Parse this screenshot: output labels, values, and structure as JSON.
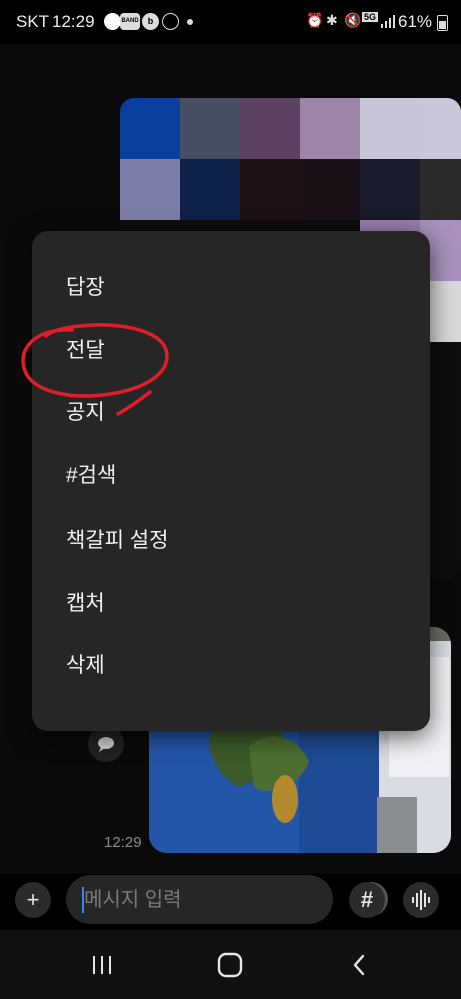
{
  "status_bar": {
    "carrier": "SKT",
    "time": "12:29",
    "battery": "61%",
    "network": "5G",
    "app_icons": [
      "yogiyo-icon",
      "band-icon",
      "b-icon",
      "figure-icon"
    ],
    "b_glyph": "b",
    "band_label": "BAND"
  },
  "chat": {
    "timestamp": "12:29"
  },
  "context_menu": {
    "items": [
      {
        "label": "답장"
      },
      {
        "label": "전달"
      },
      {
        "label": "공지"
      },
      {
        "label": "#검색"
      },
      {
        "label": "책갈피 설정"
      },
      {
        "label": "캡처"
      },
      {
        "label": "삭제"
      }
    ]
  },
  "input_bar": {
    "placeholder": "메시지 입력",
    "plus_label": "+",
    "hash_label": "#"
  },
  "colors": {
    "annotation": "#e11d2a",
    "menu_bg": "#262626",
    "caret": "#3b82f6"
  },
  "pixel_colors": [
    "#0a3f9e",
    "#474f63",
    "#5a4260",
    "#9b86a8",
    "#c7c5d6",
    "#c9c7d8",
    "#7c7ea8",
    "#10214a",
    "#1f1116",
    "#1b1218",
    "#171b2a",
    "#2a2a2a",
    "#0e0e0e",
    "#0e0e0e",
    "#0e0e0e",
    "#0e0e0e",
    "#9a7fae",
    "#a891bd",
    "#0e0e0e",
    "#0e0e0e",
    "#0e0e0e",
    "#0e0e0e",
    "#d8d8da",
    "#d8d8da",
    "#0e0e0e",
    "#0e0e0e",
    "#0e0e0e",
    "#0e0e0e",
    "#0e0e0e",
    "#0e0e0e",
    "#0e0e0e",
    "#0e0e0e",
    "#0e0e0e",
    "#0e0e0e",
    "#0e0e0e",
    "#0e0e0e",
    "#0e0e0e",
    "#0e0e0e",
    "#0e0e0e",
    "#0e0e0e",
    "#0e0e0e",
    "#0e0e0e",
    "#0e0e0e",
    "#0e0e0e",
    "#0e0e0e",
    "#0e0e0e",
    "#0e0e0e",
    "#0e0e0e",
    "#0e0e0e",
    "#0e0e0e",
    "#0e0e0e",
    "#0e0e0e",
    "#0e0e0e",
    "#0e0e0e",
    "#0e0e0e",
    "#0e0e0e",
    "#0e0e0e",
    "#0e0e0e",
    "#b8a90c",
    "#b8a90c",
    "#0e0e0e",
    "#0e0e0e",
    "#0e0e0e",
    "#0e0e0e",
    "#0e0e0e",
    "#0e0e0e",
    "#0e0e0e",
    "#0e0e0e",
    "#0e0e0e",
    "#0e0e0e",
    "#0e0e0e",
    "#0e0e0e"
  ]
}
